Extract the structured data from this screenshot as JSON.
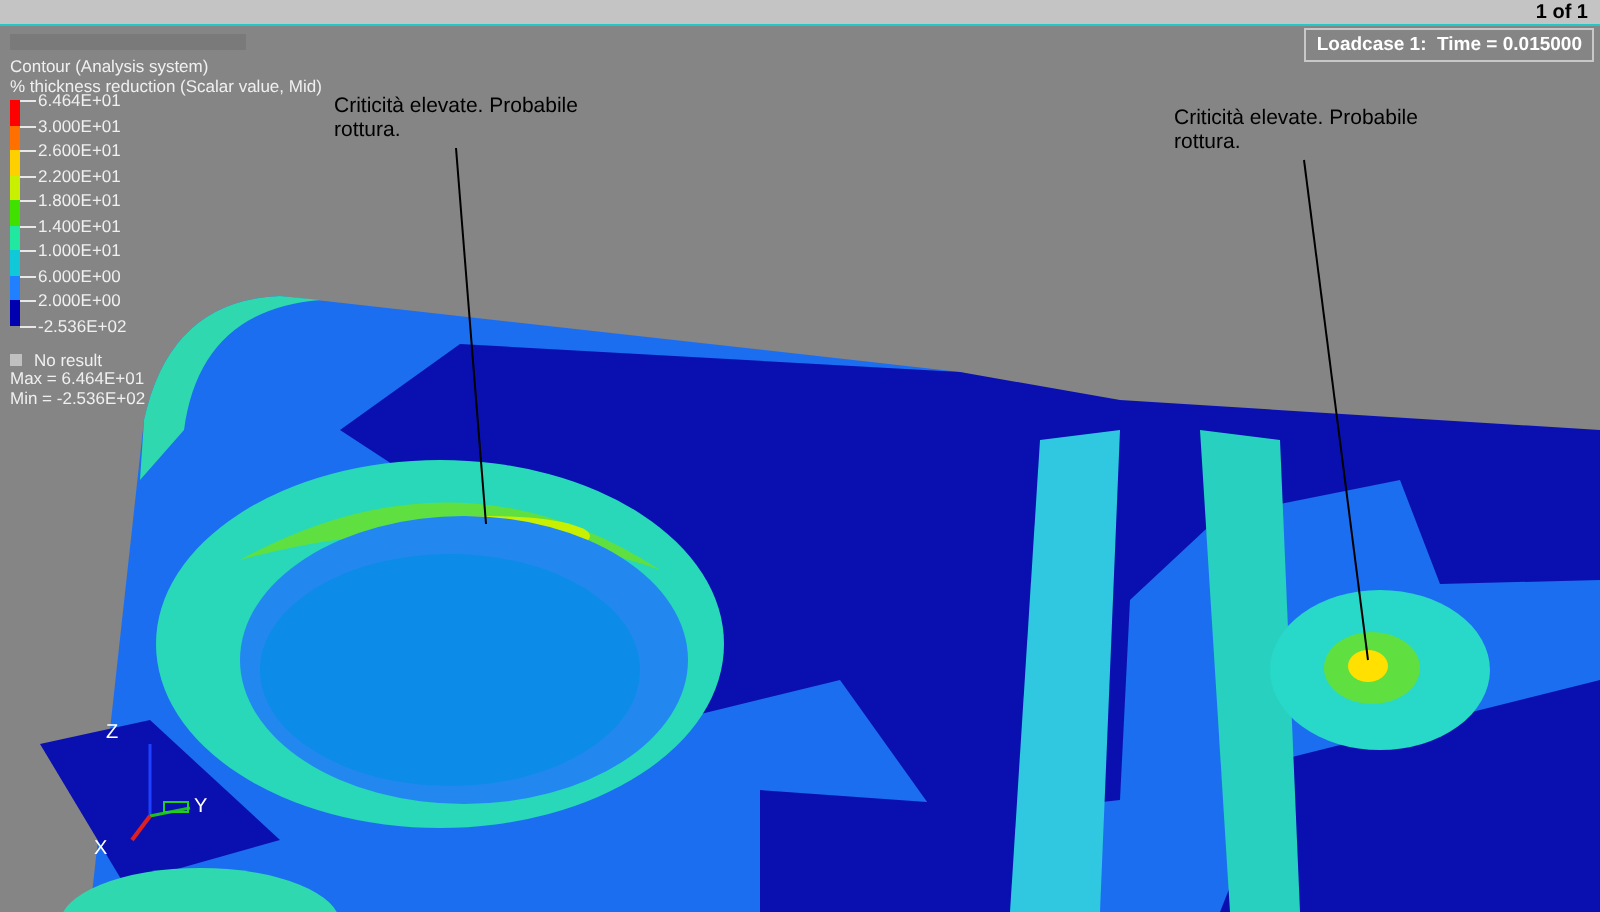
{
  "status_bar": {
    "page": "1 of 1"
  },
  "loadcase": "Loadcase 1:  Time = 0.015000",
  "legend": {
    "title": "Contour (Analysis system)",
    "subtitle": "% thickness reduction (Scalar value, Mid)",
    "levels": [
      {
        "value": "6.464E+01",
        "color": "#ff0000"
      },
      {
        "value": "3.000E+01",
        "color": "#ff7000"
      },
      {
        "value": "2.600E+01",
        "color": "#ffd000"
      },
      {
        "value": "2.200E+01",
        "color": "#c8f000"
      },
      {
        "value": "1.800E+01",
        "color": "#40e000"
      },
      {
        "value": "1.400E+01",
        "color": "#20e8a0"
      },
      {
        "value": "1.000E+01",
        "color": "#10c8d8"
      },
      {
        "value": "6.000E+00",
        "color": "#2080ff"
      },
      {
        "value": "2.000E+00",
        "color": "#0000b0"
      }
    ],
    "min_level": "-2.536E+02",
    "no_result": "No result",
    "max": "Max = 6.464E+01",
    "min": "Min = -2.536E+02"
  },
  "annotations": [
    {
      "text": "Criticità elevate. Probabile rottura."
    },
    {
      "text": "Criticità elevate. Probabile rottura."
    }
  ],
  "triad": {
    "z": "Z",
    "y": "Y",
    "x": "X"
  }
}
